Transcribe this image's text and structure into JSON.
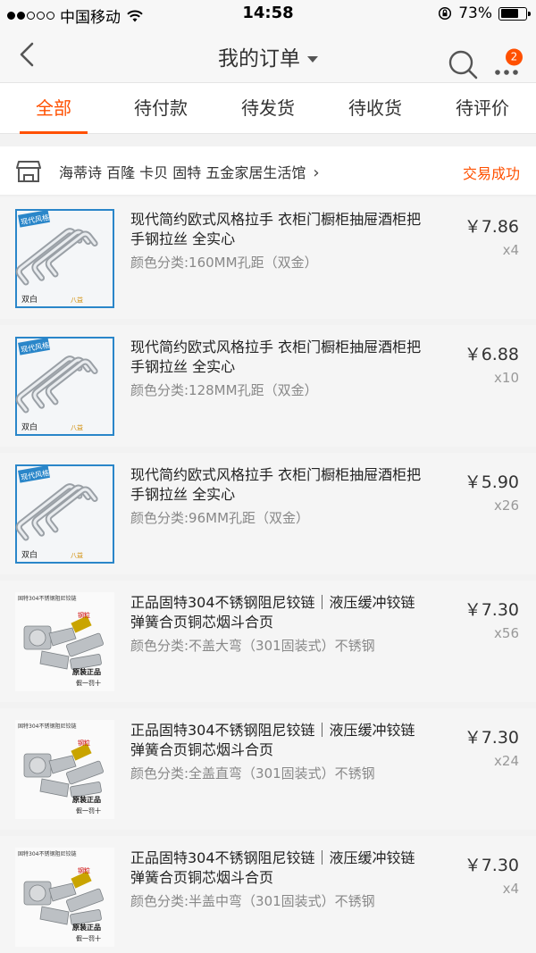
{
  "status_bar": {
    "carrier": "中国移动",
    "time": "14:58",
    "battery": "73%",
    "battery_level": 0.73,
    "signal_dots_filled": 2,
    "signal_dots_total": 5
  },
  "nav": {
    "title": "我的订单",
    "badge": "2",
    "icons": [
      "back-icon",
      "search-icon",
      "more-icon"
    ]
  },
  "tabs": [
    {
      "label": "全部",
      "active": true
    },
    {
      "label": "待付款",
      "active": false
    },
    {
      "label": "待发货",
      "active": false
    },
    {
      "label": "待收货",
      "active": false
    },
    {
      "label": "待评价",
      "active": false
    }
  ],
  "shop": {
    "name": "海蒂诗 百隆 卡贝 固特 五金家居生活馆",
    "status": "交易成功",
    "icon": "store-icon"
  },
  "items": [
    {
      "title": "现代简约欧式风格拉手 衣柜门橱柜抽屉酒柜把手钢拉丝 全实心",
      "spec": "颜色分类:160MM孔距（双金）",
      "price": "￥7.86",
      "qty": "x4",
      "thumb": "handle",
      "thumb_labels": [
        "现代风格",
        "双白",
        "八益"
      ]
    },
    {
      "title": "现代简约欧式风格拉手 衣柜门橱柜抽屉酒柜把手钢拉丝 全实心",
      "spec": "颜色分类:128MM孔距（双金）",
      "price": "￥6.88",
      "qty": "x10",
      "thumb": "handle",
      "thumb_labels": [
        "现代风格",
        "双白",
        "八益"
      ]
    },
    {
      "title": "现代简约欧式风格拉手 衣柜门橱柜抽屉酒柜把手钢拉丝 全实心",
      "spec": "颜色分类:96MM孔距（双金）",
      "price": "￥5.90",
      "qty": "x26",
      "thumb": "handle",
      "thumb_labels": [
        "现代风格",
        "双白",
        "八益"
      ]
    },
    {
      "title": "正品固特304不锈钢阻尼铰链｜液压缓冲铰链弹簧合页铜芯烟斗合页",
      "spec": "颜色分类:不盖大弯（301固装式）不锈钢",
      "price": "￥7.30",
      "qty": "x56",
      "thumb": "hinge",
      "thumb_labels": [
        "固特304不锈钢阻尼铰链",
        "钢粒",
        "原装正品",
        "假一罚十"
      ]
    },
    {
      "title": "正品固特304不锈钢阻尼铰链｜液压缓冲铰链弹簧合页铜芯烟斗合页",
      "spec": "颜色分类:全盖直弯（301固装式）不锈钢",
      "price": "￥7.30",
      "qty": "x24",
      "thumb": "hinge",
      "thumb_labels": [
        "固特304不锈钢阻尼铰链",
        "钢粒",
        "原装正品",
        "假一罚十"
      ]
    },
    {
      "title": "正品固特304不锈钢阻尼铰链｜液压缓冲铰链弹簧合页铜芯烟斗合页",
      "spec": "颜色分类:半盖中弯（301固装式）不锈钢",
      "price": "￥7.30",
      "qty": "x4",
      "thumb": "hinge",
      "thumb_labels": [
        "固特304不锈钢阻尼铰链",
        "钢粒",
        "原装正品",
        "假一罚十"
      ]
    }
  ],
  "colors": {
    "accent": "#ff5000",
    "text": "#333333",
    "muted": "#888888",
    "background": "#f2f2f2"
  }
}
